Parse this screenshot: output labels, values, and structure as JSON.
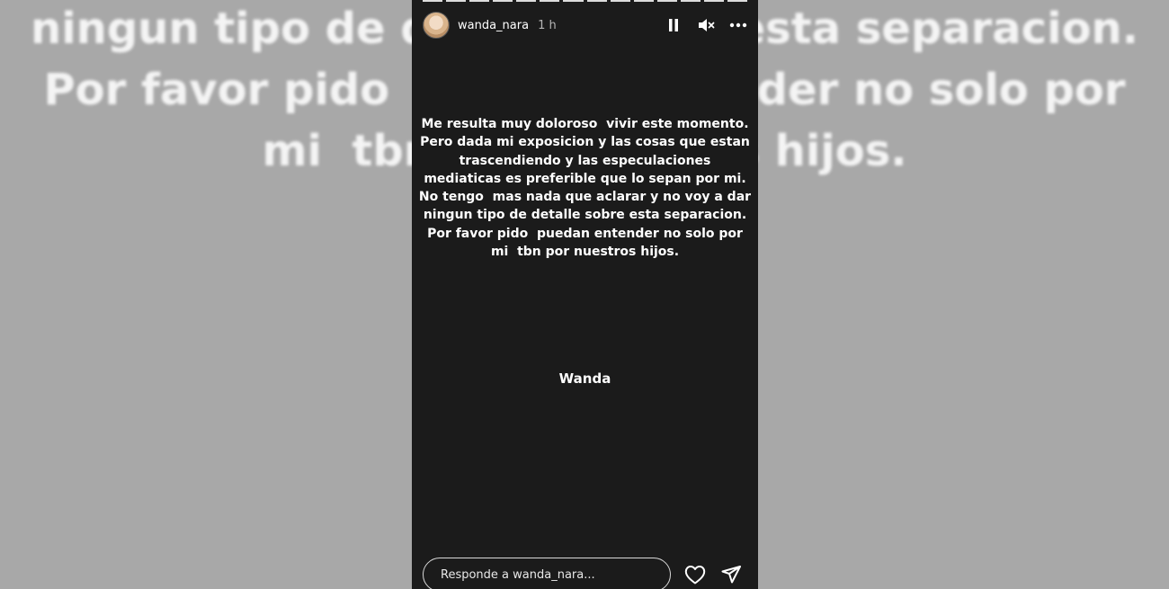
{
  "background": {
    "lines": [
      "ningun tipo de detalle sobre esta separacion.",
      "Por favor pido  puedan entender no solo por",
      "mi  tbn por nuestros hijos."
    ]
  },
  "story": {
    "progress_segments": 14,
    "user": {
      "username": "wanda_nara",
      "time": "1 h"
    },
    "controls": {
      "icons": [
        "pause-icon",
        "mute-icon",
        "more-icon"
      ]
    },
    "message": "Me resulta muy doloroso  vivir este momento.\nPero dada mi exposicion y las cosas que estan\ntrascendiendo y las especulaciones\nmediaticas es preferible que lo sepan por mi.\nNo tengo  mas nada que aclarar y no voy a dar\nningun tipo de detalle sobre esta separacion.\nPor favor pido  puedan entender no solo por\nmi  tbn por nuestros hijos.",
    "signature": "Wanda",
    "reply": {
      "placeholder": "Responde a wanda_nara..."
    },
    "footer_icons": [
      "heart-icon",
      "send-icon"
    ]
  },
  "colors": {
    "background": "#a8a8a8",
    "story_background": "#1b1b1b",
    "text": "#ffffff"
  }
}
